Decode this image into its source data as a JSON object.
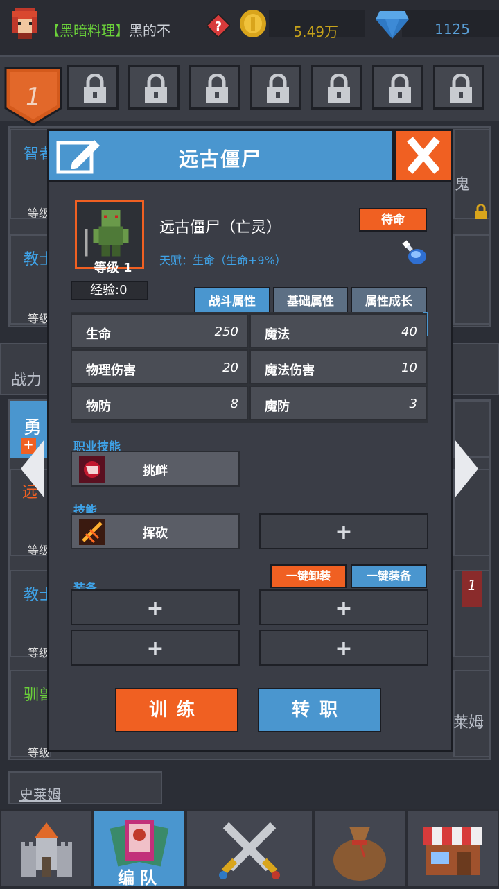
{
  "player": {
    "guild": "【黑暗料理】",
    "name": "黑的不"
  },
  "currency": {
    "gold": "5.49万",
    "gems": "1125"
  },
  "formation": {
    "active_slot": "1"
  },
  "background": {
    "left_labels": [
      "智者",
      "教士",
      "战力",
      "勇",
      "远",
      "教士",
      "驯兽"
    ],
    "level_stub": "等级",
    "right_labels": [
      "鬼",
      "莱姆"
    ],
    "bottom_label": "史莱姆",
    "right_badge": "1"
  },
  "modal": {
    "title": "远古僵尸",
    "hero_name": "远古僵尸（亡灵）",
    "level": "等级 1",
    "talent": "天赋：生命（生命+9%）",
    "standby_btn": "待命",
    "exp": "经验:0",
    "tabs": [
      "战斗属性",
      "基础属性",
      "属性成长"
    ],
    "stats": [
      {
        "k": "生命",
        "v": "250"
      },
      {
        "k": "魔法",
        "v": "40"
      },
      {
        "k": "物理伤害",
        "v": "20"
      },
      {
        "k": "魔法伤害",
        "v": "10"
      },
      {
        "k": "物防",
        "v": "8"
      },
      {
        "k": "魔防",
        "v": "3"
      }
    ],
    "class_skill_label": "职业技能",
    "class_skill": "挑衅",
    "skill_label": "技能",
    "skill": "挥砍",
    "equip_label": "装备",
    "unequip_all": "一键卸装",
    "equip_all": "一键装备",
    "plus": "+",
    "train_btn": "训练",
    "class_change_btn": "转职"
  },
  "nav": {
    "active_label": "编队"
  },
  "colors": {
    "accent_orange": "#f06022",
    "accent_blue": "#4a96cf",
    "talent_blue": "#3fa3e8"
  }
}
